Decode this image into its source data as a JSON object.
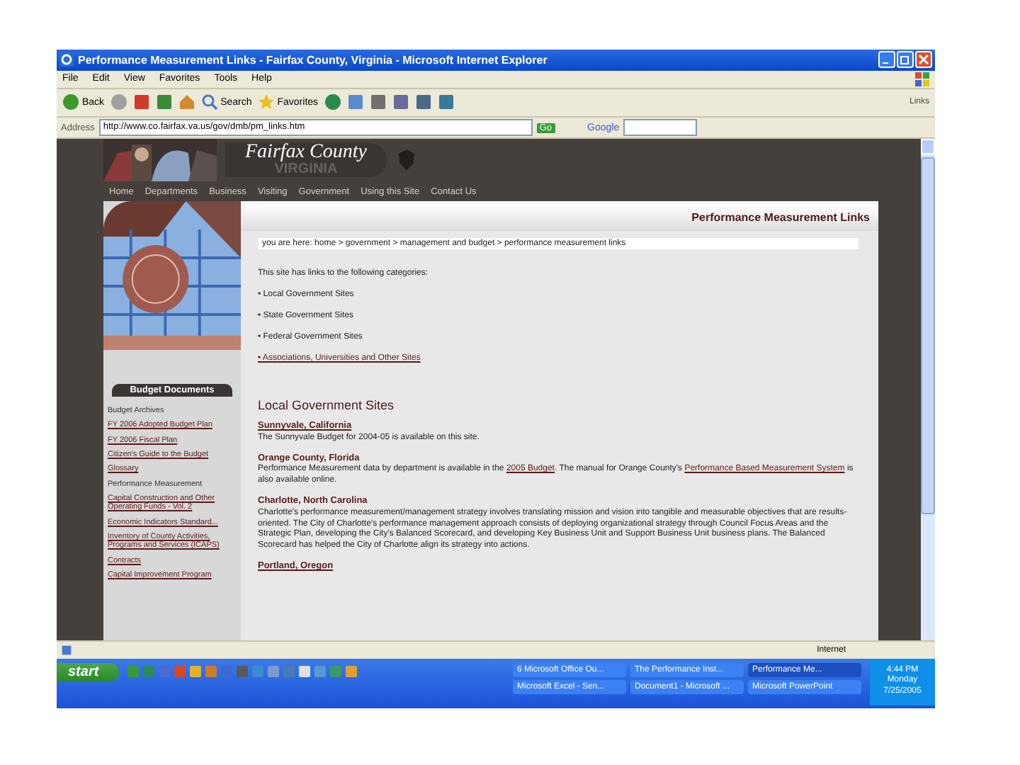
{
  "window": {
    "title": "Performance Measurement Links - Fairfax County, Virginia - Microsoft Internet Explorer"
  },
  "menu": [
    "File",
    "Edit",
    "View",
    "Favorites",
    "Tools",
    "Help"
  ],
  "toolbar": [
    {
      "kind": "back",
      "label": "Back"
    },
    {
      "kind": "forward"
    },
    {
      "kind": "stop"
    },
    {
      "kind": "refresh"
    },
    {
      "kind": "home"
    },
    {
      "kind": "search",
      "label": "Search"
    },
    {
      "kind": "favorites",
      "label": "Favorites"
    },
    {
      "kind": "media"
    },
    {
      "kind": "mail"
    },
    {
      "kind": "print"
    },
    {
      "kind": "edit"
    },
    {
      "kind": "discuss"
    },
    {
      "kind": "messenger"
    }
  ],
  "links_label": "Links",
  "address": {
    "label": "Address",
    "value": "http://www.co.fairfax.va.us/gov/dmb/pm_links.htm",
    "go": "Go",
    "search_brand": "Google"
  },
  "site": {
    "brand": "Fairfax County",
    "state": "VIRGINIA",
    "nav": [
      "Home",
      "Departments",
      "Business",
      "Visiting",
      "Government",
      "Using this Site",
      "Contact Us"
    ]
  },
  "sidebar": {
    "heading": "Budget Documents",
    "links": [
      {
        "text": "Budget Archives",
        "underlined": false
      },
      {
        "text": "FY 2006 Adopted Budget Plan",
        "underlined": true
      },
      {
        "text": "FY 2006 Fiscal Plan",
        "underlined": true
      },
      {
        "text": "Citizen's Guide to the Budget",
        "underlined": true
      },
      {
        "text": "Glossary",
        "underlined": true
      },
      {
        "text": "Performance Measurement",
        "underlined": false
      },
      {
        "text": "Capital Construction and Other Operating Funds - Vol. 2",
        "underlined": true
      },
      {
        "text": "Economic Indicators Standard...",
        "underlined": true
      },
      {
        "text": "Inventory of County Activities, Programs and Services (ICAPS)",
        "underlined": true
      },
      {
        "text": "Contracts",
        "underlined": true
      },
      {
        "text": "Capital Improvement Program",
        "underlined": true
      }
    ]
  },
  "main": {
    "page_title": "Performance Measurement Links",
    "breadcrumb": "you are here: home > government > management and budget > performance measurement links",
    "intro": "This site has links to the following categories:",
    "categories": [
      {
        "text": "• Local Government Sites",
        "underlined": false
      },
      {
        "text": "• State Government Sites",
        "underlined": false
      },
      {
        "text": "• Federal Government Sites",
        "underlined": false
      },
      {
        "text": "• Associations, Universities and Other Sites",
        "underlined": true
      }
    ],
    "section_title": "Local Government Sites",
    "entries": [
      {
        "name": "Sunnyvale, California",
        "underlined": true,
        "description": [
          {
            "text": "The Sunnyvale Budget for 2004-05 is available on this site.",
            "link": false
          }
        ]
      },
      {
        "name": "Orange County, Florida",
        "underlined": false,
        "description": [
          {
            "text": "Performance Measurement data by department is available in the ",
            "link": false
          },
          {
            "text": "2005 Budget",
            "link": true
          },
          {
            "text": ". The manual for Orange County's ",
            "link": false
          },
          {
            "text": "Performance Based Measurement System",
            "link": true
          },
          {
            "text": " is also available online.",
            "link": false
          }
        ]
      },
      {
        "name": "Charlotte, North Carolina",
        "underlined": false,
        "description": [
          {
            "text": "Charlotte's performance measurement/management strategy involves translating mission and vision into tangible and measurable objectives that are results-oriented. The City of Charlotte's performance management approach consists of deploying organizational strategy through Council Focus Areas and the Strategic Plan, developing the City's Balanced Scorecard, and developing Key Business Unit and Support Business Unit business plans. The Balanced Scorecard has helped the City of Charlotte align its strategy into actions.",
            "link": false
          }
        ]
      },
      {
        "name": "Portland, Oregon",
        "underlined": true
      }
    ]
  },
  "status_bar": {
    "zone": "Internet"
  },
  "taskbar": {
    "start": "start",
    "tasks": [
      {
        "label": "6 Microsoft Office Ou...",
        "selected": false
      },
      {
        "label": "The Performance Inst...",
        "selected": false
      },
      {
        "label": "Performance Me...",
        "selected": true
      },
      {
        "label": "Microsoft Excel - Sen...",
        "selected": false
      },
      {
        "label": "Document1 - Microsoft ...",
        "selected": false
      },
      {
        "label": "Microsoft PowerPoint",
        "selected": false
      }
    ],
    "clock": [
      "4:44 PM",
      "Monday",
      "7/25/2005"
    ]
  }
}
